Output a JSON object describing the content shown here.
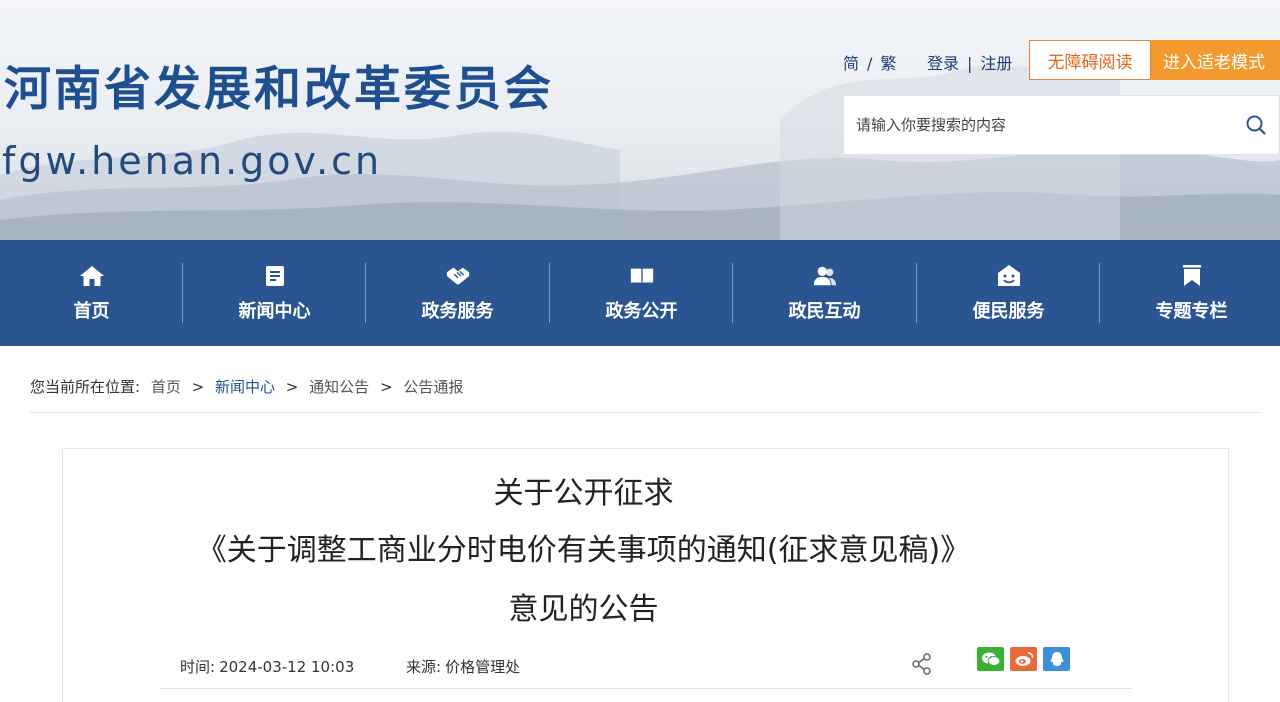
{
  "header": {
    "site_title": "河南省发展和改革委员会",
    "site_domain": "fgw.henan.gov.cn",
    "lang_simplified": "简",
    "lang_sep": "/",
    "lang_traditional": "繁",
    "login": "登录",
    "auth_sep": "|",
    "register": "注册",
    "accessible_reading": "无障碍阅读",
    "elder_mode": "进入适老模式",
    "search_placeholder": "请输入你要搜索的内容"
  },
  "nav": {
    "items": [
      {
        "label": "首页",
        "icon": "home-icon"
      },
      {
        "label": "新闻中心",
        "icon": "news-icon"
      },
      {
        "label": "政务服务",
        "icon": "handshake-icon"
      },
      {
        "label": "政务公开",
        "icon": "book-icon"
      },
      {
        "label": "政民互动",
        "icon": "people-icon"
      },
      {
        "label": "便民服务",
        "icon": "smiley-house-icon"
      },
      {
        "label": "专题专栏",
        "icon": "bookmark-icon"
      }
    ]
  },
  "breadcrumb": {
    "prefix": "您当前所在位置:",
    "items": [
      "首页",
      "新闻中心",
      "通知公告",
      "公告通报"
    ],
    "separator": ">"
  },
  "article": {
    "title_line1": "关于公开征求",
    "title_line2": "《关于调整工商业分时电价有关事项的通知(征求意见稿)》",
    "title_line3": "意见的公告",
    "time_label": "时间:",
    "time_value": "2024-03-12 10:03",
    "source_label": "来源:",
    "source_value": "价格管理处"
  },
  "colors": {
    "brand_blue": "#2a5590",
    "title_blue": "#1f4f8f",
    "accent_orange": "#f39a2e",
    "wechat_green": "#3cb034",
    "weibo_orange": "#e86a3a",
    "qq_blue": "#3d8fd8"
  }
}
